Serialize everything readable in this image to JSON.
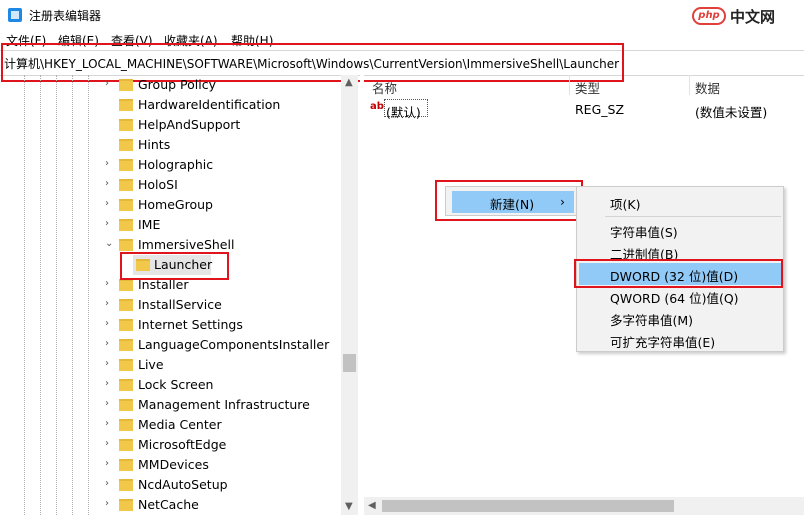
{
  "window": {
    "title": "注册表编辑器"
  },
  "watermark": {
    "logo": "php",
    "text": "中文网"
  },
  "menu": [
    "文件(F)",
    "编辑(E)",
    "查看(V)",
    "收藏夹(A)",
    "帮助(H)"
  ],
  "address": "计算机\\HKEY_LOCAL_MACHINE\\SOFTWARE\\Microsoft\\Windows\\CurrentVersion\\ImmersiveShell\\Launcher",
  "tree": {
    "items": [
      {
        "label": "Group Policy",
        "expander": "›"
      },
      {
        "label": "HardwareIdentification",
        "expander": ""
      },
      {
        "label": "HelpAndSupport",
        "expander": ""
      },
      {
        "label": "Hints",
        "expander": ""
      },
      {
        "label": "Holographic",
        "expander": "›"
      },
      {
        "label": "HoloSI",
        "expander": "›"
      },
      {
        "label": "HomeGroup",
        "expander": "›"
      },
      {
        "label": "IME",
        "expander": "›"
      },
      {
        "label": "ImmersiveShell",
        "expander": "⌄"
      },
      {
        "label": "Launcher",
        "expander": ""
      },
      {
        "label": "Installer",
        "expander": "›"
      },
      {
        "label": "InstallService",
        "expander": "›"
      },
      {
        "label": "Internet Settings",
        "expander": "›"
      },
      {
        "label": "LanguageComponentsInstaller",
        "expander": "›"
      },
      {
        "label": "Live",
        "expander": "›"
      },
      {
        "label": "Lock Screen",
        "expander": "›"
      },
      {
        "label": "Management Infrastructure",
        "expander": "›"
      },
      {
        "label": "Media Center",
        "expander": "›"
      },
      {
        "label": "MicrosoftEdge",
        "expander": "›"
      },
      {
        "label": "MMDevices",
        "expander": "›"
      },
      {
        "label": "NcdAutoSetup",
        "expander": "›"
      },
      {
        "label": "NetCache",
        "expander": "›"
      }
    ]
  },
  "list": {
    "columns": [
      "名称",
      "类型",
      "数据"
    ],
    "rows": [
      {
        "name": "(默认)",
        "type": "REG_SZ",
        "data": "(数值未设置)"
      }
    ]
  },
  "context_menu": {
    "new_label": "新建(N)",
    "new_arrow": "›",
    "submenu": [
      "项(K)",
      "字符串值(S)",
      "二进制值(B)",
      "DWORD (32 位)值(D)",
      "QWORD (64 位)值(Q)",
      "多字符串值(M)",
      "可扩充字符串值(E)"
    ],
    "highlighted_index": 3
  },
  "colors": {
    "highlight": "#91c9f7",
    "annotation_red": "#e0141c",
    "folder": "#f2c84b"
  }
}
